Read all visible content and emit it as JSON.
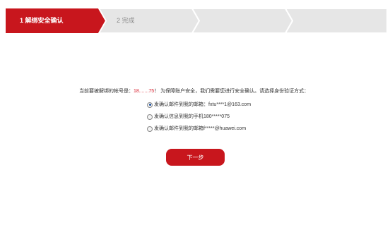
{
  "steps": [
    {
      "label": "1 解绑安全确认",
      "active": true
    },
    {
      "label": "2 完成",
      "active": false
    },
    {
      "label": "",
      "active": false
    },
    {
      "label": "",
      "active": false
    }
  ],
  "colors": {
    "active_step": "#c8161d",
    "inactive_step": "#e6e6e6",
    "account_highlight": "#d9212e",
    "button": "#c8161d"
  },
  "prompt": {
    "prefix": "当前要被解绑的帐号是：",
    "account": "18.......75",
    "suffix": "！ 为保障账户安全，我们需要您进行安全确认。请选择身份验证方式："
  },
  "options": [
    {
      "label": "发确认邮件到我的邮箱：",
      "value": "fxtu****1@163.com",
      "checked": true
    },
    {
      "label": "发确认信息到我的手机 ",
      "value": "180*****075",
      "checked": false
    },
    {
      "label": "发确认邮件到我的邮箱 ",
      "value": "f*****@huawei.com",
      "checked": false
    }
  ],
  "next_button": {
    "label": "下一步"
  }
}
